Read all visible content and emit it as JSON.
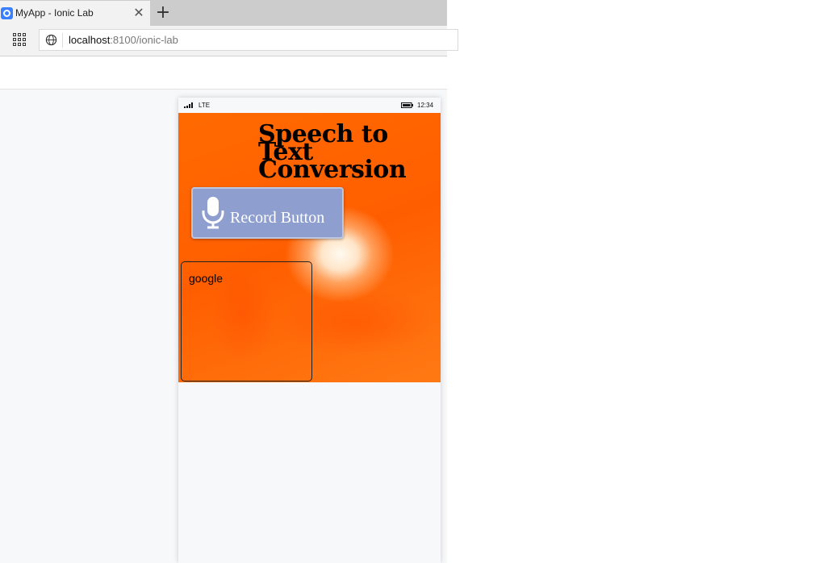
{
  "browser": {
    "tab_title": "MyApp - Ionic Lab",
    "tab_icon": "ionic-logo-icon",
    "new_tab_icon": "plus-icon",
    "url_host": "localhost",
    "url_rest": ":8100/ionic-lab"
  },
  "device": {
    "carrier": "LTE",
    "time": "12:34"
  },
  "app": {
    "title": "Speech to Text Conversion",
    "record_button_label": "Record Button",
    "result_text": "google",
    "colors": {
      "background": "#ff6a00",
      "button": "#8e9fcf"
    }
  }
}
